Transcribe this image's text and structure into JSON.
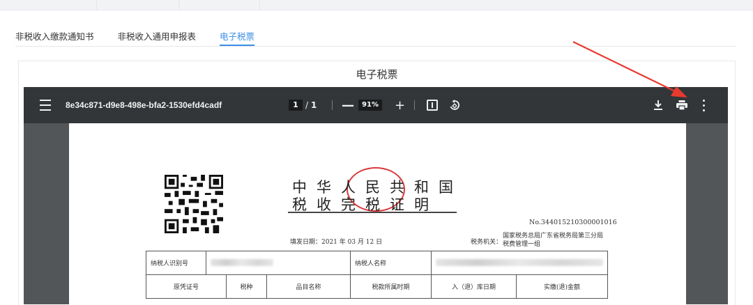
{
  "tabs": [
    {
      "label": "非税收入缴款通知书"
    },
    {
      "label": "非税收入通用申报表"
    },
    {
      "label": "电子税票"
    }
  ],
  "active_tab": "电子税票",
  "card": {
    "title": "电子税票"
  },
  "viewer": {
    "file_name": "8e34c871-d9e8-498e-bfa2-1530efd4cadf",
    "page_current": "1",
    "page_separator": "/",
    "page_total": "1",
    "zoom_out": "—",
    "zoom": "91%",
    "zoom_in": "+",
    "icons": {
      "menu": "menu-icon",
      "fit": "fit-page-icon",
      "rotate": "rotate-icon",
      "download": "download-icon",
      "print": "print-icon",
      "more": "more-vert-icon"
    }
  },
  "document": {
    "title_line1": "中华人民共和国",
    "title_line2": "税收完税证明",
    "number": "No.344015210300001016",
    "fill_date": "填发日期：2021 年 03 月 12 日",
    "tax_office_label": "税务机关：",
    "tax_office": "国家税务总局广东省税务局第三分局税费管理一组",
    "row1": {
      "taxpayer_id_label": "纳税人识别号",
      "taxpayer_name_label": "纳税人名称"
    },
    "columns": [
      "原凭证号",
      "税种",
      "品目名称",
      "税款所属时期",
      "入（退）库日期",
      "实缴(退)金额"
    ]
  },
  "colors": {
    "accent": "#3a8ee6",
    "toolbar": "#323639",
    "viewer_bg": "#525659",
    "stamp": "#d93a3a",
    "annotation_arrow": "#e83a2f"
  }
}
